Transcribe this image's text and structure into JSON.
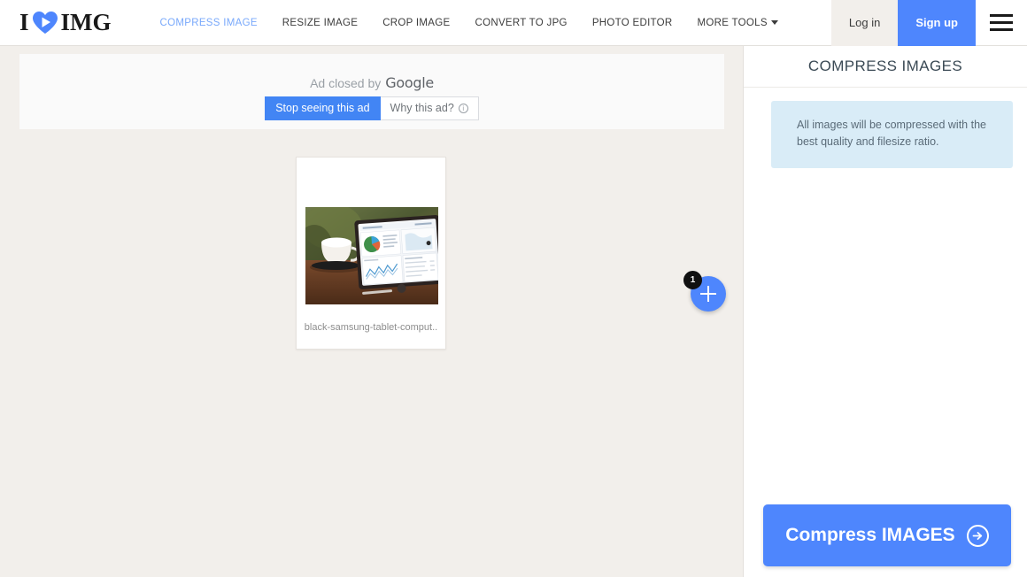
{
  "header": {
    "logo": {
      "pre": "I",
      "icon": "heart-icon",
      "post": "IMG"
    },
    "nav": [
      {
        "label": "COMPRESS IMAGE",
        "active": true
      },
      {
        "label": "RESIZE IMAGE",
        "active": false
      },
      {
        "label": "CROP IMAGE",
        "active": false
      },
      {
        "label": "CONVERT TO JPG",
        "active": false
      },
      {
        "label": "PHOTO EDITOR",
        "active": false
      },
      {
        "label": "MORE TOOLS",
        "active": false,
        "caret": true
      }
    ],
    "login_label": "Log in",
    "signup_label": "Sign up",
    "menu_icon": "hamburger-icon"
  },
  "ad": {
    "closed_text": "Ad closed by",
    "brand": "Google",
    "stop_label": "Stop seeing this ad",
    "why_label": "Why this ad?",
    "why_icon": "info-icon"
  },
  "workspace": {
    "thumbnail": {
      "filename": "black-samsung-tablet-comput..",
      "alt": "black samsung tablet computer on wooden desk beside white coffee cup"
    },
    "add_button": {
      "icon": "plus-icon",
      "badge_count": "1"
    }
  },
  "sidebar": {
    "title": "COMPRESS IMAGES",
    "info_text": "All images will be compressed with the best quality and filesize ratio.",
    "action_label": "Compress IMAGES",
    "action_icon": "arrow-right-circle-icon"
  },
  "colors": {
    "accent_blue": "#4e86fd",
    "nav_active": "#79a9fb",
    "page_bg": "#f2efeb",
    "info_bg": "#d9ecf7",
    "ad_blue": "#4285f4"
  }
}
